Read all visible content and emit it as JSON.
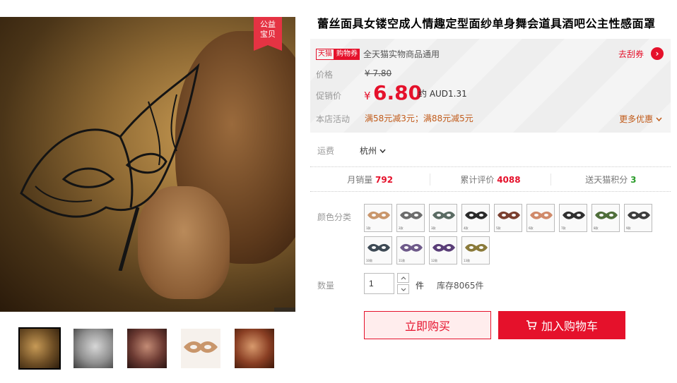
{
  "gallery": {
    "charity_badge": [
      "公益",
      "宝贝"
    ],
    "thumbnails": [
      "thumb-1",
      "thumb-2",
      "thumb-3",
      "thumb-4",
      "thumb-5"
    ]
  },
  "product": {
    "title": "蕾丝面具女镂空成人情趣定型面纱单身舞会道具酒吧公主性感面罩"
  },
  "promo": {
    "tag_tmall": "天猫",
    "tag_coupon": "购物券",
    "coupon_text": "全天猫实物商品通用",
    "get_coupon": "去刮券",
    "price_label": "价格",
    "old_price": "¥ 7.80",
    "promo_label": "促销价",
    "currency": "¥",
    "promo_price": "6.80",
    "aud": "约 AUD1.31",
    "activity_label": "本店活动",
    "activity": "满58元减3元；满88元减5元",
    "more_offer": "更多优惠"
  },
  "shipping": {
    "label": "运费",
    "city": "杭州"
  },
  "stats": {
    "monthly_sales_label": "月销量",
    "monthly_sales": "792",
    "reviews_label": "累计评价",
    "reviews": "4088",
    "points_label": "送天猫积分",
    "points": "3"
  },
  "colors": {
    "label": "颜色分类",
    "options": [
      {
        "color": "#c9966b",
        "cap": "1款"
      },
      {
        "color": "#6c6c6c",
        "cap": "2款"
      },
      {
        "color": "#5a6b63",
        "cap": "3款"
      },
      {
        "color": "#2a2a2a",
        "cap": "4款"
      },
      {
        "color": "#7a3f2f",
        "cap": "5款"
      },
      {
        "color": "#d08a6a",
        "cap": "6款"
      },
      {
        "color": "#303030",
        "cap": "7款"
      },
      {
        "color": "#4f6e3a",
        "cap": "8款"
      },
      {
        "color": "#3c3c3c",
        "cap": "9款"
      },
      {
        "color": "#3e4a55",
        "cap": "10款"
      },
      {
        "color": "#6e5a8a",
        "cap": "11款"
      },
      {
        "color": "#5a3e78",
        "cap": "12款"
      },
      {
        "color": "#8a7a3a",
        "cap": "13款"
      }
    ]
  },
  "quantity": {
    "label": "数量",
    "value": "1",
    "unit": "件",
    "stock": "库存8065件"
  },
  "actions": {
    "buy_now": "立即购买",
    "add_cart": "加入购物车"
  },
  "theme": {
    "accent": "#e5112b"
  }
}
